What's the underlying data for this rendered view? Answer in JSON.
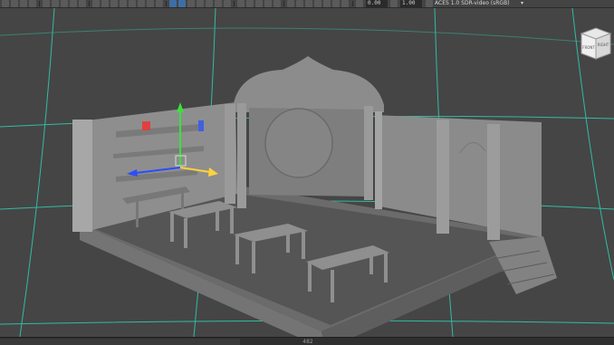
{
  "toolbar": {
    "exposure_value": "0.00",
    "gamma_value": "1.00",
    "view_transform": "ACES 1.0 SDR-video (sRGB)",
    "icons": [
      "snap-grid-icon",
      "snap-curve-icon",
      "snap-point-icon",
      "snap-view-icon",
      "camera-icon",
      "lock-icon",
      "bookmark-icon",
      "isolate-icon",
      "wireframe-icon",
      "shaded-icon",
      "textured-icon",
      "lights-icon",
      "shadows-icon",
      "ambient-occlusion-icon",
      "motion-blur-icon",
      "anti-aliasing-icon",
      "depth-of-field-icon",
      "xray-icon",
      "xray-joints-icon",
      "xray-components-icon"
    ]
  },
  "viewcube": {
    "front_label": "FRONT",
    "right_label": "RIGHT"
  },
  "manipulator": {
    "x_axis_color": "#ffd23c",
    "y_axis_color": "#3ce03c",
    "z_axis_color": "#2c4dff",
    "x_plane_color": "#e04040",
    "z_plane_color": "#4060e0"
  },
  "timeline": {
    "current_frame": "482"
  },
  "colors": {
    "viewport_bg": "#454545",
    "grid_line": "#2fd0b4",
    "selection_highlight": "#7fc2ff"
  }
}
